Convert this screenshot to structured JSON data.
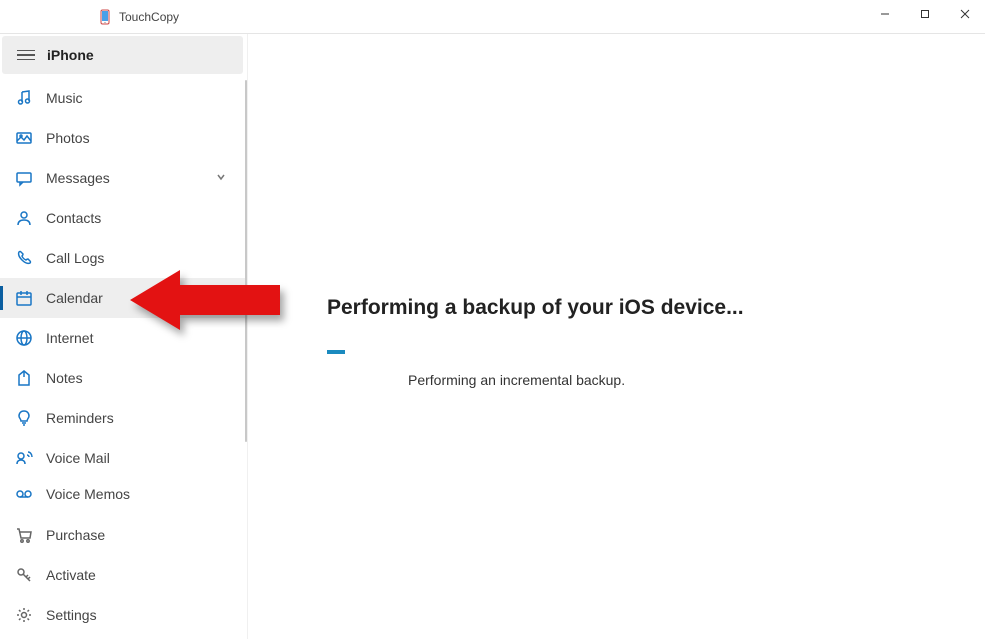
{
  "app": {
    "title": "TouchCopy"
  },
  "device": {
    "name": "iPhone"
  },
  "sidebar": {
    "items": [
      {
        "label": "Music"
      },
      {
        "label": "Photos"
      },
      {
        "label": "Messages"
      },
      {
        "label": "Contacts"
      },
      {
        "label": "Call Logs"
      },
      {
        "label": "Calendar"
      },
      {
        "label": "Internet"
      },
      {
        "label": "Notes"
      },
      {
        "label": "Reminders"
      },
      {
        "label": "Voice Mail"
      },
      {
        "label": "Voice Memos"
      }
    ],
    "bottom": [
      {
        "label": "Purchase"
      },
      {
        "label": "Activate"
      },
      {
        "label": "Settings"
      }
    ]
  },
  "main": {
    "heading": "Performing a backup of your iOS device...",
    "subtext": "Performing an incremental backup."
  }
}
